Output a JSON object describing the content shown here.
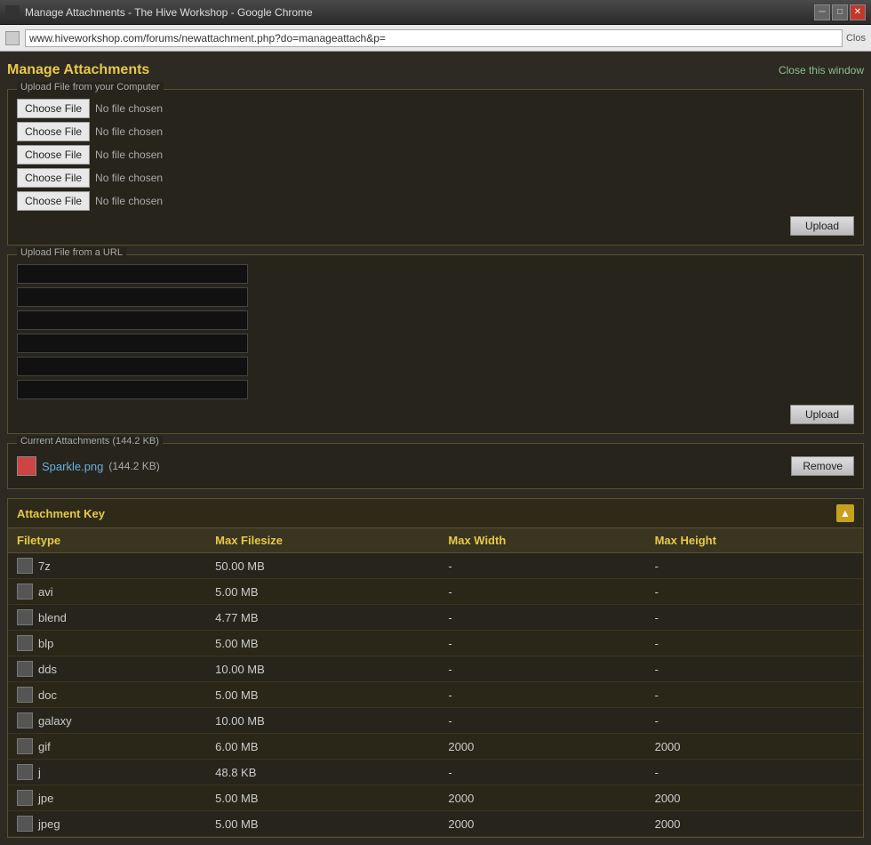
{
  "window": {
    "title": "Manage Attachments - The Hive Workshop - Google Chrome",
    "address": "www.hiveworkshop.com/forums/newattachment.php?do=manageattach&p=",
    "close_tab_label": "Clos"
  },
  "header": {
    "title": "Manage Attachments",
    "close_link": "Close this window"
  },
  "upload_from_computer": {
    "legend": "Upload File from your Computer",
    "rows": [
      {
        "button": "Choose File",
        "status": "No file chosen"
      },
      {
        "button": "Choose File",
        "status": "No file chosen"
      },
      {
        "button": "Choose File",
        "status": "No file chosen"
      },
      {
        "button": "Choose File",
        "status": "No file chosen"
      },
      {
        "button": "Choose File",
        "status": "No file chosen"
      }
    ],
    "upload_button": "Upload"
  },
  "upload_from_url": {
    "legend": "Upload File from a URL",
    "upload_button": "Upload",
    "num_inputs": 6
  },
  "current_attachments": {
    "legend": "Current Attachments (144.2 KB)",
    "items": [
      {
        "name": "Sparkle.png",
        "size": "(144.2 KB)"
      }
    ],
    "remove_button": "Remove"
  },
  "attachment_key": {
    "title": "Attachment Key",
    "columns": [
      "Filetype",
      "Max Filesize",
      "Max Width",
      "Max Height"
    ],
    "rows": [
      {
        "type": "7z",
        "size": "50.00 MB",
        "width": "-",
        "height": "-"
      },
      {
        "type": "avi",
        "size": "5.00 MB",
        "width": "-",
        "height": "-"
      },
      {
        "type": "blend",
        "size": "4.77 MB",
        "width": "-",
        "height": "-"
      },
      {
        "type": "blp",
        "size": "5.00 MB",
        "width": "-",
        "height": "-"
      },
      {
        "type": "dds",
        "size": "10.00 MB",
        "width": "-",
        "height": "-"
      },
      {
        "type": "doc",
        "size": "5.00 MB",
        "width": "-",
        "height": "-"
      },
      {
        "type": "galaxy",
        "size": "10.00 MB",
        "width": "-",
        "height": "-"
      },
      {
        "type": "gif",
        "size": "6.00 MB",
        "width": "2000",
        "height": "2000"
      },
      {
        "type": "j",
        "size": "48.8 KB",
        "width": "-",
        "height": "-"
      },
      {
        "type": "jpe",
        "size": "5.00 MB",
        "width": "2000",
        "height": "2000"
      },
      {
        "type": "jpeg",
        "size": "5.00 MB",
        "width": "2000",
        "height": "2000"
      }
    ]
  }
}
